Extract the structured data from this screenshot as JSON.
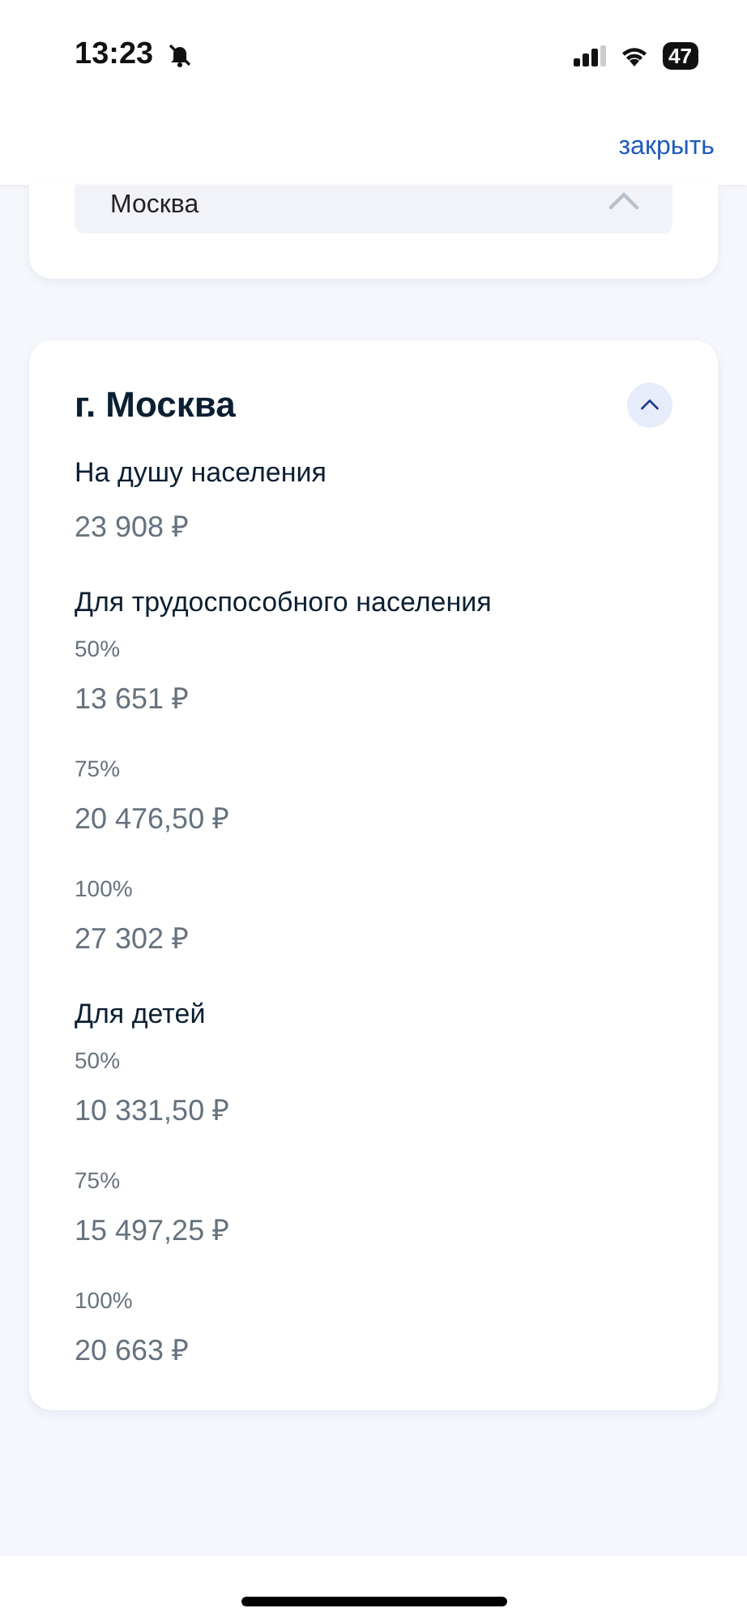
{
  "status_bar": {
    "time": "13:23",
    "battery": "47"
  },
  "header": {
    "close_link": "закрыть"
  },
  "region_field": {
    "value": "Москва",
    "expanded": true
  },
  "card": {
    "title": "г. Москва",
    "expanded": true,
    "sections": [
      {
        "label": "На душу населения",
        "rows": [
          {
            "amount": "23 908 ₽"
          }
        ]
      },
      {
        "label": "Для трудоспособного населения",
        "rows": [
          {
            "share": "50%",
            "amount": "13 651 ₽"
          },
          {
            "share": "75%",
            "amount": "20 476,50 ₽"
          },
          {
            "share": "100%",
            "amount": "27 302 ₽"
          }
        ]
      },
      {
        "label": "Для детей",
        "rows": [
          {
            "share": "50%",
            "amount": "10 331,50 ₽"
          },
          {
            "share": "75%",
            "amount": "15 497,25 ₽"
          },
          {
            "share": "100%",
            "amount": "20 663 ₽"
          }
        ]
      }
    ]
  }
}
